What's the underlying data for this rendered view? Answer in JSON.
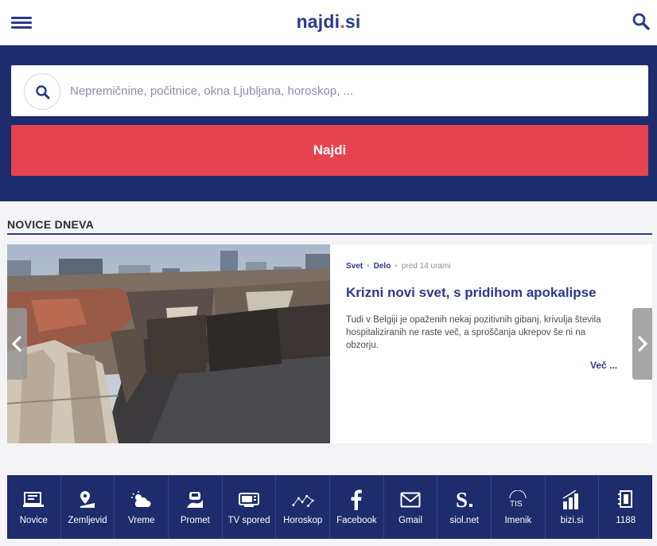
{
  "header": {
    "logo_main": "najdi",
    "logo_dot": ".",
    "logo_tld": "si",
    "menu_icon": "hamburger-menu-icon",
    "search_icon": "search-icon"
  },
  "search": {
    "placeholder": "Nepremičnine, počitnice, okna Ljubljana, horoskop, ...",
    "value": "",
    "button_label": "Najdi"
  },
  "news": {
    "section_title": "NOVICE DNEVA",
    "category": "Svet",
    "source": "Delo",
    "time": "pred 14 urami",
    "headline": "Krizni novi svet, s pridihom apokalipse",
    "summary": "Tudi v Belgiji je opaženih nekaj pozitivnih gibanj, krivulja števila hospitaliziranih ne raste več, a sproščanja ukrepov še ni na obzorju.",
    "more_label": "Več ..."
  },
  "iconbar": [
    {
      "label": "Novice",
      "icon": "newspaper-icon"
    },
    {
      "label": "Zemljevid",
      "icon": "map-pin-icon"
    },
    {
      "label": "Vreme",
      "icon": "weather-icon"
    },
    {
      "label": "Promet",
      "icon": "car-icon"
    },
    {
      "label": "TV spored",
      "icon": "tv-icon"
    },
    {
      "label": "Horoskop",
      "icon": "constellation-icon"
    },
    {
      "label": "Facebook",
      "icon": "facebook-icon"
    },
    {
      "label": "Gmail",
      "icon": "mail-icon"
    },
    {
      "label": "siol.net",
      "icon": "siol-icon"
    },
    {
      "label": "Imenik",
      "icon": "tis-icon"
    },
    {
      "label": "bizi.si",
      "icon": "chart-icon"
    },
    {
      "label": "1188",
      "icon": "phonebook-icon"
    }
  ],
  "colors": {
    "brand": "#2a3a8c",
    "band": "#1c2c6c",
    "accent": "#e5434f"
  }
}
